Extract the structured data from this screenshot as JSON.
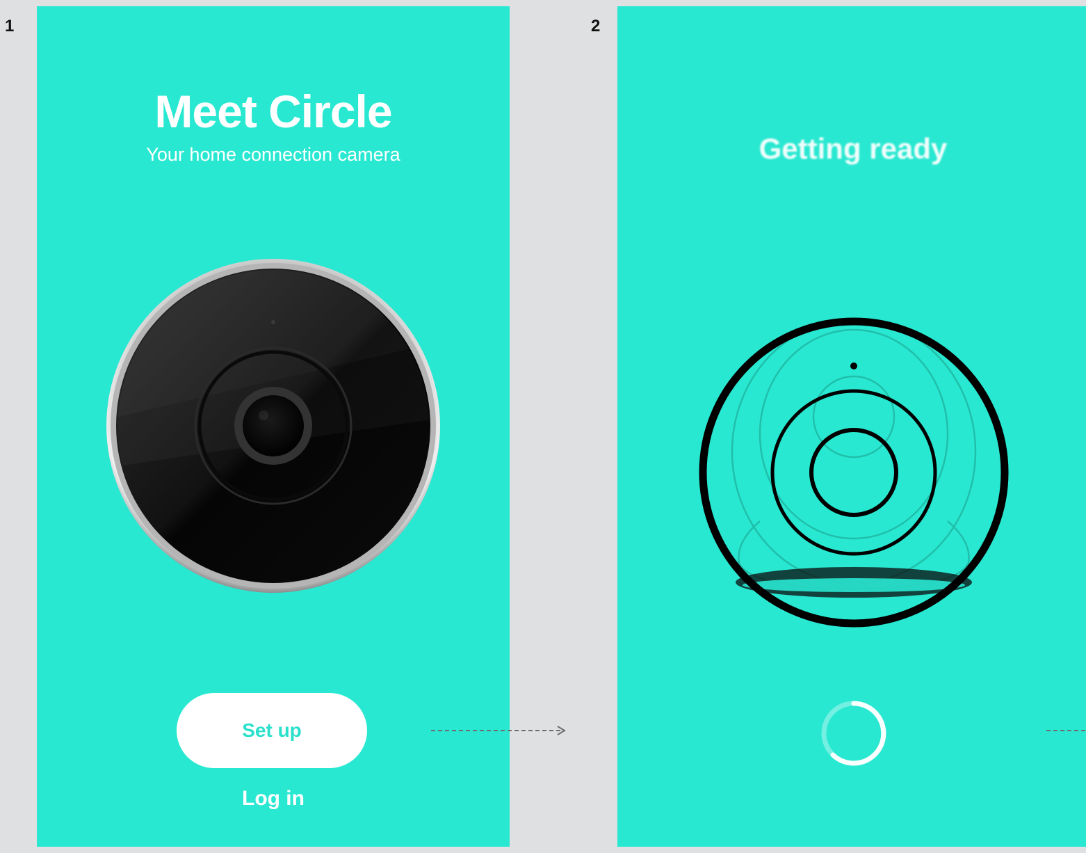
{
  "steps": [
    {
      "number": "1",
      "title": "Meet Circle",
      "subtitle": "Your home connection camera",
      "primary_button": "Set up",
      "secondary_link": "Log in",
      "image": "camera-photo"
    },
    {
      "number": "2",
      "title": "Getting ready",
      "image": "camera-wireframe",
      "status_indicator": "loading-spinner"
    }
  ],
  "colors": {
    "screen_background": "#29e8d1",
    "page_background": "#dfe0e1",
    "button_fill": "#ffffff",
    "button_text": "#29e0cb",
    "text": "#ffffff"
  },
  "icons": [
    "flow-arrow-icon",
    "loading-spinner-icon",
    "camera-wireframe-icon"
  ]
}
